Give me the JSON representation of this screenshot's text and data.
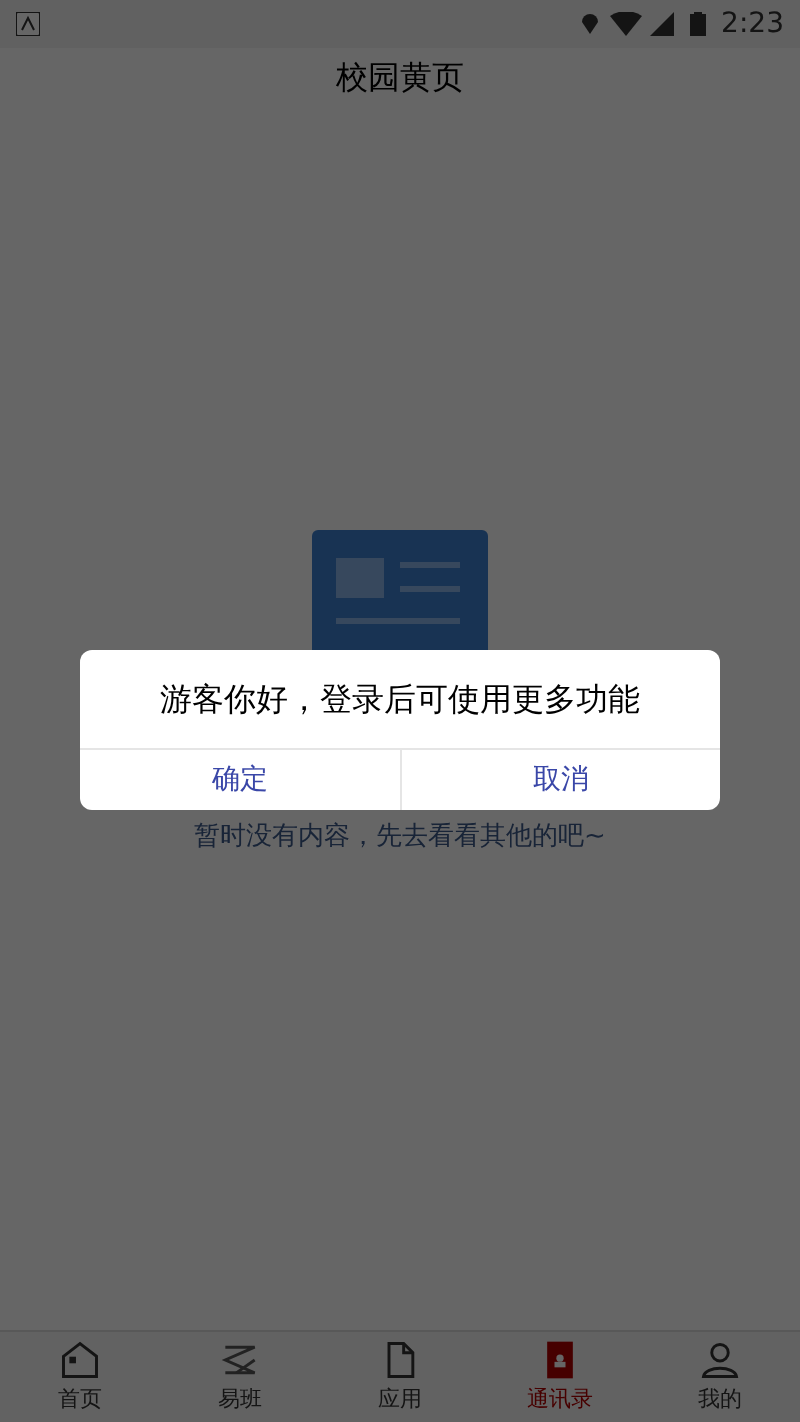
{
  "status_bar": {
    "time": "2:23"
  },
  "header": {
    "title": "校园黄页"
  },
  "empty_state": {
    "message": "暂时没有内容，先去看看其他的吧~"
  },
  "dialog": {
    "message": "游客你好，登录后可使用更多功能",
    "buttons": [
      "确定",
      "取消"
    ]
  },
  "tabs": [
    {
      "label": "首页",
      "kind": "home",
      "selected": false
    },
    {
      "label": "易班",
      "kind": "yiban",
      "selected": false
    },
    {
      "label": "应用",
      "kind": "apps",
      "selected": false
    },
    {
      "label": "通讯录",
      "kind": "contacts",
      "selected": true
    },
    {
      "label": "我的",
      "kind": "me",
      "selected": false
    }
  ]
}
